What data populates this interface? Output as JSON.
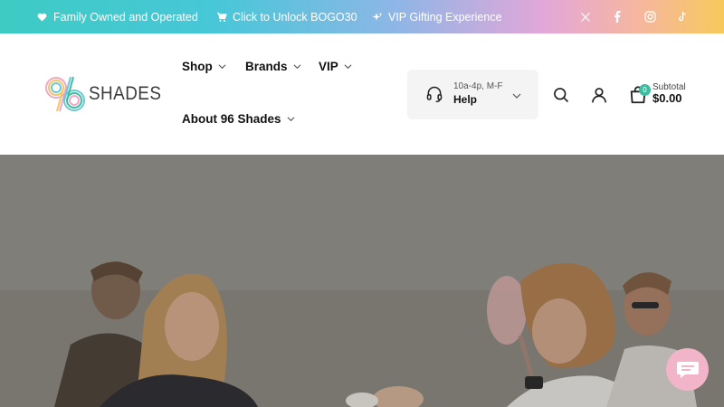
{
  "announcement": {
    "items": [
      {
        "icon": "heart-icon",
        "text": "Family Owned and Operated"
      },
      {
        "icon": "cart-icon",
        "text": "Click to Unlock BOGO30"
      },
      {
        "icon": "sparkle-icon",
        "text": "VIP Gifting Experience"
      }
    ],
    "social": [
      "x-icon",
      "facebook-icon",
      "instagram-icon",
      "tiktok-icon"
    ]
  },
  "header": {
    "logo_text": "SHADES",
    "nav": {
      "shop": "Shop",
      "brands": "Brands",
      "vip": "VIP",
      "about": "About 96 Shades"
    },
    "help": {
      "hours": "10a-4p, M-F",
      "label": "Help"
    },
    "cart": {
      "count": "0",
      "subtotal_label": "Subtotal",
      "subtotal_value": "$0.00"
    }
  },
  "colors": {
    "accent_teal": "#3dcbc4",
    "cart_badge": "#3dbd9f",
    "chat_button": "#f2b4c9"
  }
}
